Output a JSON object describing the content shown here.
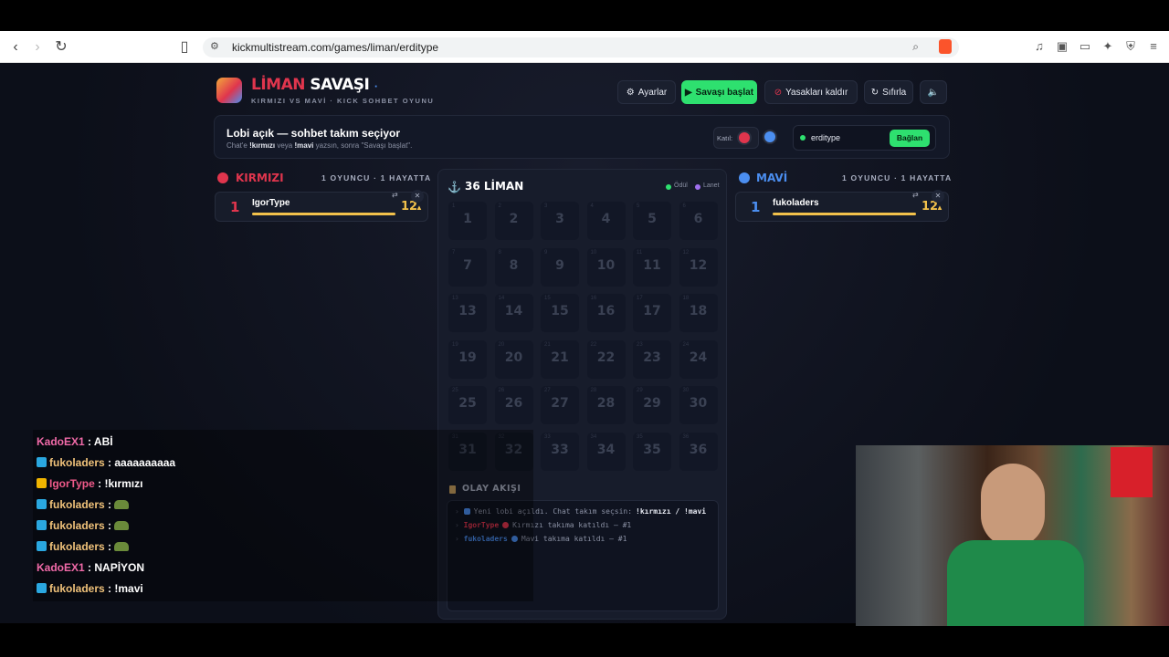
{
  "browser": {
    "url": "kickmultistream.com/games/liman/erditype"
  },
  "header": {
    "title_part1": "LİMAN",
    "title_part2": "SAVAŞI",
    "subtitle": "KIRMIZI VS MAVİ · KICK SOHBET OYUNU"
  },
  "toolbar": {
    "settings": "Ayarlar",
    "start": "Savaşı başlat",
    "unban": "Yasakları kaldır",
    "reset": "Sıfırla"
  },
  "lobby": {
    "heading": "Lobi açık — sohbet takım seçiyor",
    "desc_pre": "Chat'e",
    "cmd_red": "!kırmızı",
    "desc_mid": "veya",
    "cmd_blue": "!mavi",
    "desc_post": "yazsın, sonra \"Savaşı başlat\".",
    "join_label": "Katıl:",
    "channel_value": "erditype",
    "connect": "Bağlan"
  },
  "red": {
    "name": "KIRMIZI",
    "meta": "1 OYUNCU · 1 HAYATTA",
    "player": {
      "rank": "1",
      "name": "IgorType",
      "score": "12"
    }
  },
  "blue": {
    "name": "MAVİ",
    "meta": "1 OYUNCU · 1 HAYATTA",
    "player": {
      "rank": "1",
      "name": "fukoladers",
      "score": "12"
    }
  },
  "board": {
    "title": "36 LİMAN",
    "legend_reward": "Ödül",
    "legend_curse": "Lanet",
    "cells": [
      "1",
      "2",
      "3",
      "4",
      "5",
      "6",
      "7",
      "8",
      "9",
      "10",
      "11",
      "12",
      "13",
      "14",
      "15",
      "16",
      "17",
      "18",
      "19",
      "20",
      "21",
      "22",
      "23",
      "24",
      "25",
      "26",
      "27",
      "28",
      "29",
      "30",
      "31",
      "32",
      "33",
      "34",
      "35",
      "36"
    ]
  },
  "log": {
    "title": "OLAY AKIŞI",
    "lines": [
      {
        "name": "",
        "text": "Yeni lobi açıldı. Chat takım seçsin:",
        "cmd": "!kırmızı / !mavi"
      },
      {
        "name": "IgorType",
        "text": "Kırmızı takıma katıldı — #1",
        "cmd": ""
      },
      {
        "name": "fukoladers",
        "text": "Mavi takıma katıldı — #1",
        "cmd": ""
      }
    ]
  },
  "chat": [
    {
      "user": "KadoEX1",
      "msg": "ABİ",
      "color": "#f06aa8",
      "badge": ""
    },
    {
      "user": "fukoladers",
      "msg": "aaaaaaaaaa",
      "color": "#f0c27a",
      "badge": "#2aa7e0"
    },
    {
      "user": "IgorType",
      "msg": "!kırmızı",
      "color": "#f05a8a",
      "badge": "#f0b400"
    },
    {
      "user": "fukoladers",
      "msg": "",
      "color": "#f0c27a",
      "badge": "#2aa7e0"
    },
    {
      "user": "fukoladers",
      "msg": "",
      "color": "#f0c27a",
      "badge": "#2aa7e0"
    },
    {
      "user": "fukoladers",
      "msg": "",
      "color": "#f0c27a",
      "badge": "#2aa7e0"
    },
    {
      "user": "KadoEX1",
      "msg": "NAPİYON",
      "color": "#f06aa8",
      "badge": ""
    },
    {
      "user": "fukoladers",
      "msg": "!mavi",
      "color": "#f0c27a",
      "badge": "#2aa7e0"
    }
  ],
  "colors": {
    "red": "#e0354d",
    "blue": "#4b8ef0",
    "green": "#2ee06f",
    "gold": "#f2c14b"
  }
}
